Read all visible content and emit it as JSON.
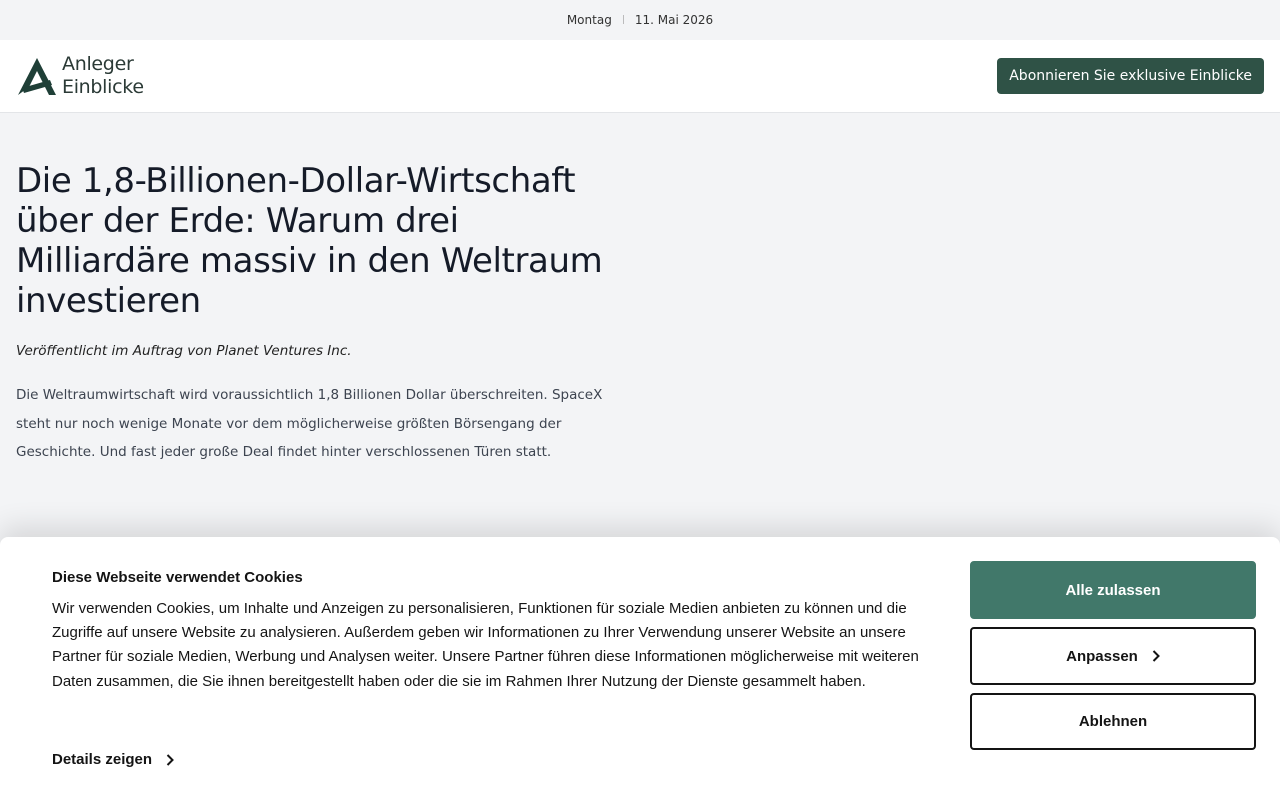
{
  "topbar": {
    "day": "Montag",
    "separator": "|",
    "date": "11. Mai 2026"
  },
  "header": {
    "logo_line1": "Anleger",
    "logo_line2": "Einblicke",
    "subscribe_label": "Abonnieren Sie exklusive Einblicke",
    "brand_color": "#2f5246"
  },
  "article": {
    "title": "Die 1,8-Billionen-Dollar-Wirtschaft über der Erde: Warum drei Milliardäre massiv in den Weltraum investieren",
    "byline": "Veröffentlicht im Auftrag von Planet Ventures Inc.",
    "lead": "Die Weltraumwirtschaft wird voraussichtlich 1,8 Billionen Dollar überschreiten. SpaceX steht nur noch wenige Monate vor dem möglicherweise größten Börsengang der Geschichte. Und fast jeder große Deal findet hinter verschlossenen Türen statt."
  },
  "cookie": {
    "title": "Diese Webseite verwendet Cookies",
    "text": "Wir verwenden Cookies, um Inhalte und Anzeigen zu personalisieren, Funktionen für soziale Medien anbieten zu können und die Zugriffe auf unsere Website zu analysieren. Außerdem geben wir Informationen zu Ihrer Verwendung unserer Website an unsere Partner für soziale Medien, Werbung und Analysen weiter. Unsere Partner führen diese Informationen möglicherweise mit weiteren Daten zusammen, die Sie ihnen bereitgestellt haben oder die sie im Rahmen Ihrer Nutzung der Dienste gesammelt haben.",
    "details_label": "Details zeigen",
    "allow_all_label": "Alle zulassen",
    "customize_label": "Anpassen",
    "decline_label": "Ablehnen",
    "accent_color": "#41786a"
  }
}
